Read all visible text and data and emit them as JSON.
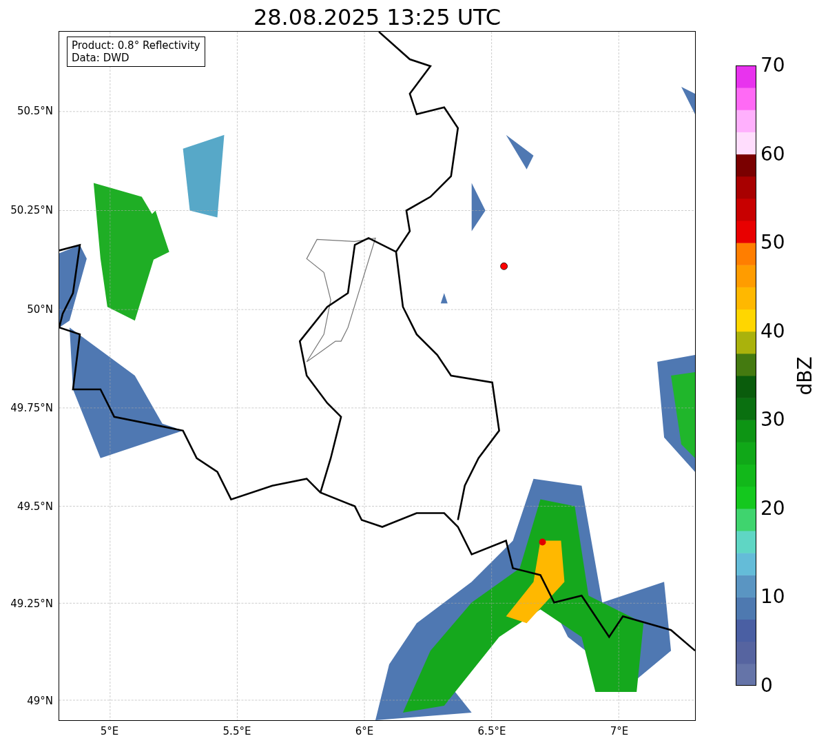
{
  "title": "28.08.2025 13:25 UTC",
  "map": {
    "legend": [
      "Product: 0.8° Reflectivity",
      "Data: DWD"
    ],
    "lat_labels": [
      "50.5°N",
      "50.25°N",
      "50°N",
      "49.75°N",
      "49.5°N",
      "49.25°N",
      "49°N"
    ],
    "lon_labels": [
      "5°E",
      "5.5°E",
      "6°E",
      "6.5°E",
      "7°E"
    ]
  },
  "colorbar": {
    "label": "dBZ",
    "ticks": [
      "70",
      "60",
      "50",
      "40",
      "30",
      "20",
      "10",
      "0"
    ]
  }
}
